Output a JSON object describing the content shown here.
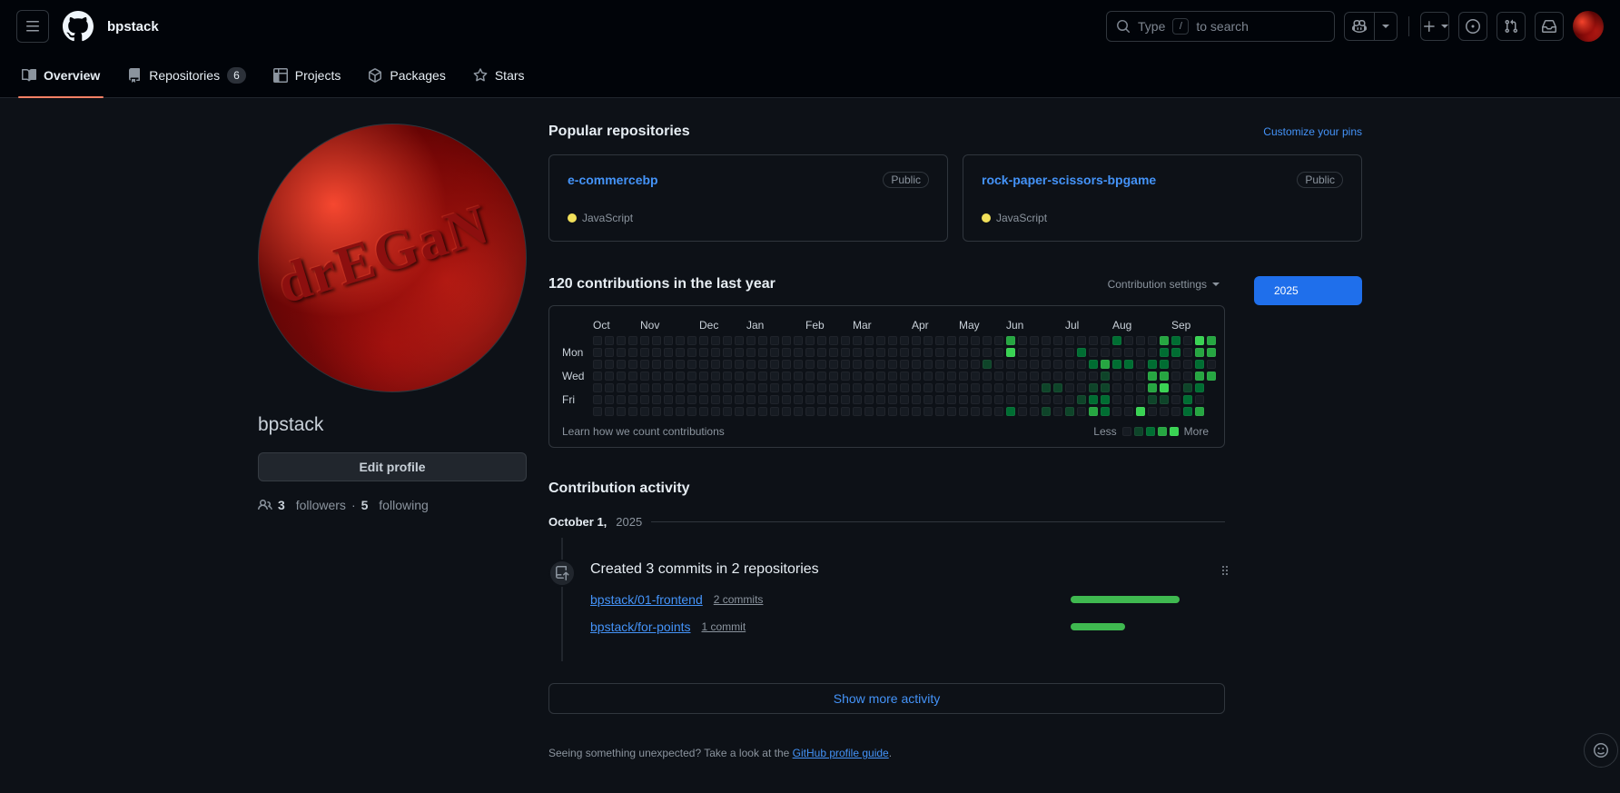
{
  "header": {
    "brand": "bpstack",
    "search": {
      "prefix": "Type",
      "key": "/",
      "suffix": "to search"
    }
  },
  "nav_tabs": [
    {
      "label": "Overview",
      "active": true
    },
    {
      "label": "Repositories",
      "count": "6"
    },
    {
      "label": "Projects"
    },
    {
      "label": "Packages"
    },
    {
      "label": "Stars"
    }
  ],
  "profile": {
    "username": "bpstack",
    "edit_button": "Edit profile",
    "followers_count": "3",
    "followers_label": "followers",
    "separator": "·",
    "following_count": "5",
    "following_label": "following",
    "avatar_word": "drEGaN"
  },
  "pinned": {
    "title": "Popular repositories",
    "customize_link": "Customize your pins",
    "repos": [
      {
        "name": "e-commercebp",
        "visibility": "Public",
        "language": "JavaScript",
        "language_color": "#f1e05a"
      },
      {
        "name": "rock-paper-scissors-bpgame",
        "visibility": "Public",
        "language": "JavaScript",
        "language_color": "#f1e05a"
      }
    ]
  },
  "contributions": {
    "heading": "120 contributions in the last year",
    "settings_label": "Contribution settings",
    "year_button": "2025",
    "months": [
      {
        "label": "Oct",
        "week": 0
      },
      {
        "label": "Nov",
        "week": 4
      },
      {
        "label": "Dec",
        "week": 9
      },
      {
        "label": "Jan",
        "week": 13
      },
      {
        "label": "Feb",
        "week": 18
      },
      {
        "label": "Mar",
        "week": 22
      },
      {
        "label": "Apr",
        "week": 27
      },
      {
        "label": "May",
        "week": 31
      },
      {
        "label": "Jun",
        "week": 35
      },
      {
        "label": "Jul",
        "week": 40
      },
      {
        "label": "Aug",
        "week": 44
      },
      {
        "label": "Sep",
        "week": 49
      }
    ],
    "day_labels": [
      {
        "label": "Mon",
        "row": 1
      },
      {
        "label": "Wed",
        "row": 3
      },
      {
        "label": "Fri",
        "row": 5
      }
    ],
    "grid_rows": [
      "00000000000000000000000000000000000300000000200032043",
      "00000000000000000000000000000000000400000200000022033",
      "00000000000000000000000000000000010000000023220220020",
      "00000000000000000000000000000000000000000001000330033",
      "0000000000000000000000000000000000000011001100034012.",
      "0000000000000000000000000000000000000000012200011020.",
      "0000000000000000000000000000000000020010103200400023."
    ],
    "legend": {
      "less": "Less",
      "more": "More",
      "levels": [
        "#161b22",
        "#0e4429",
        "#006d32",
        "#26a641",
        "#39d353"
      ]
    },
    "footnote": "Learn how we count contributions"
  },
  "activity": {
    "heading": "Contribution activity",
    "date": {
      "bold": "October 1,",
      "year": "2025"
    },
    "event": {
      "title": "Created 3 commits in 2 repositories",
      "rows": [
        {
          "repo": "bpstack/01-frontend",
          "commits_label": "2 commits",
          "commits": 2
        },
        {
          "repo": "bpstack/for-points",
          "commits_label": "1 commit",
          "commits": 1
        }
      ],
      "bar_color": "#3fb950"
    },
    "show_more": "Show more activity"
  },
  "footer": {
    "text": "Seeing something unexpected? Take a look at the ",
    "link": "GitHub profile guide",
    "period": "."
  },
  "colors": {
    "link_blue": "#4493f8",
    "button_blue": "#1f6feb",
    "tab_underline": "#f78166",
    "bar_green": "#3fb950"
  }
}
